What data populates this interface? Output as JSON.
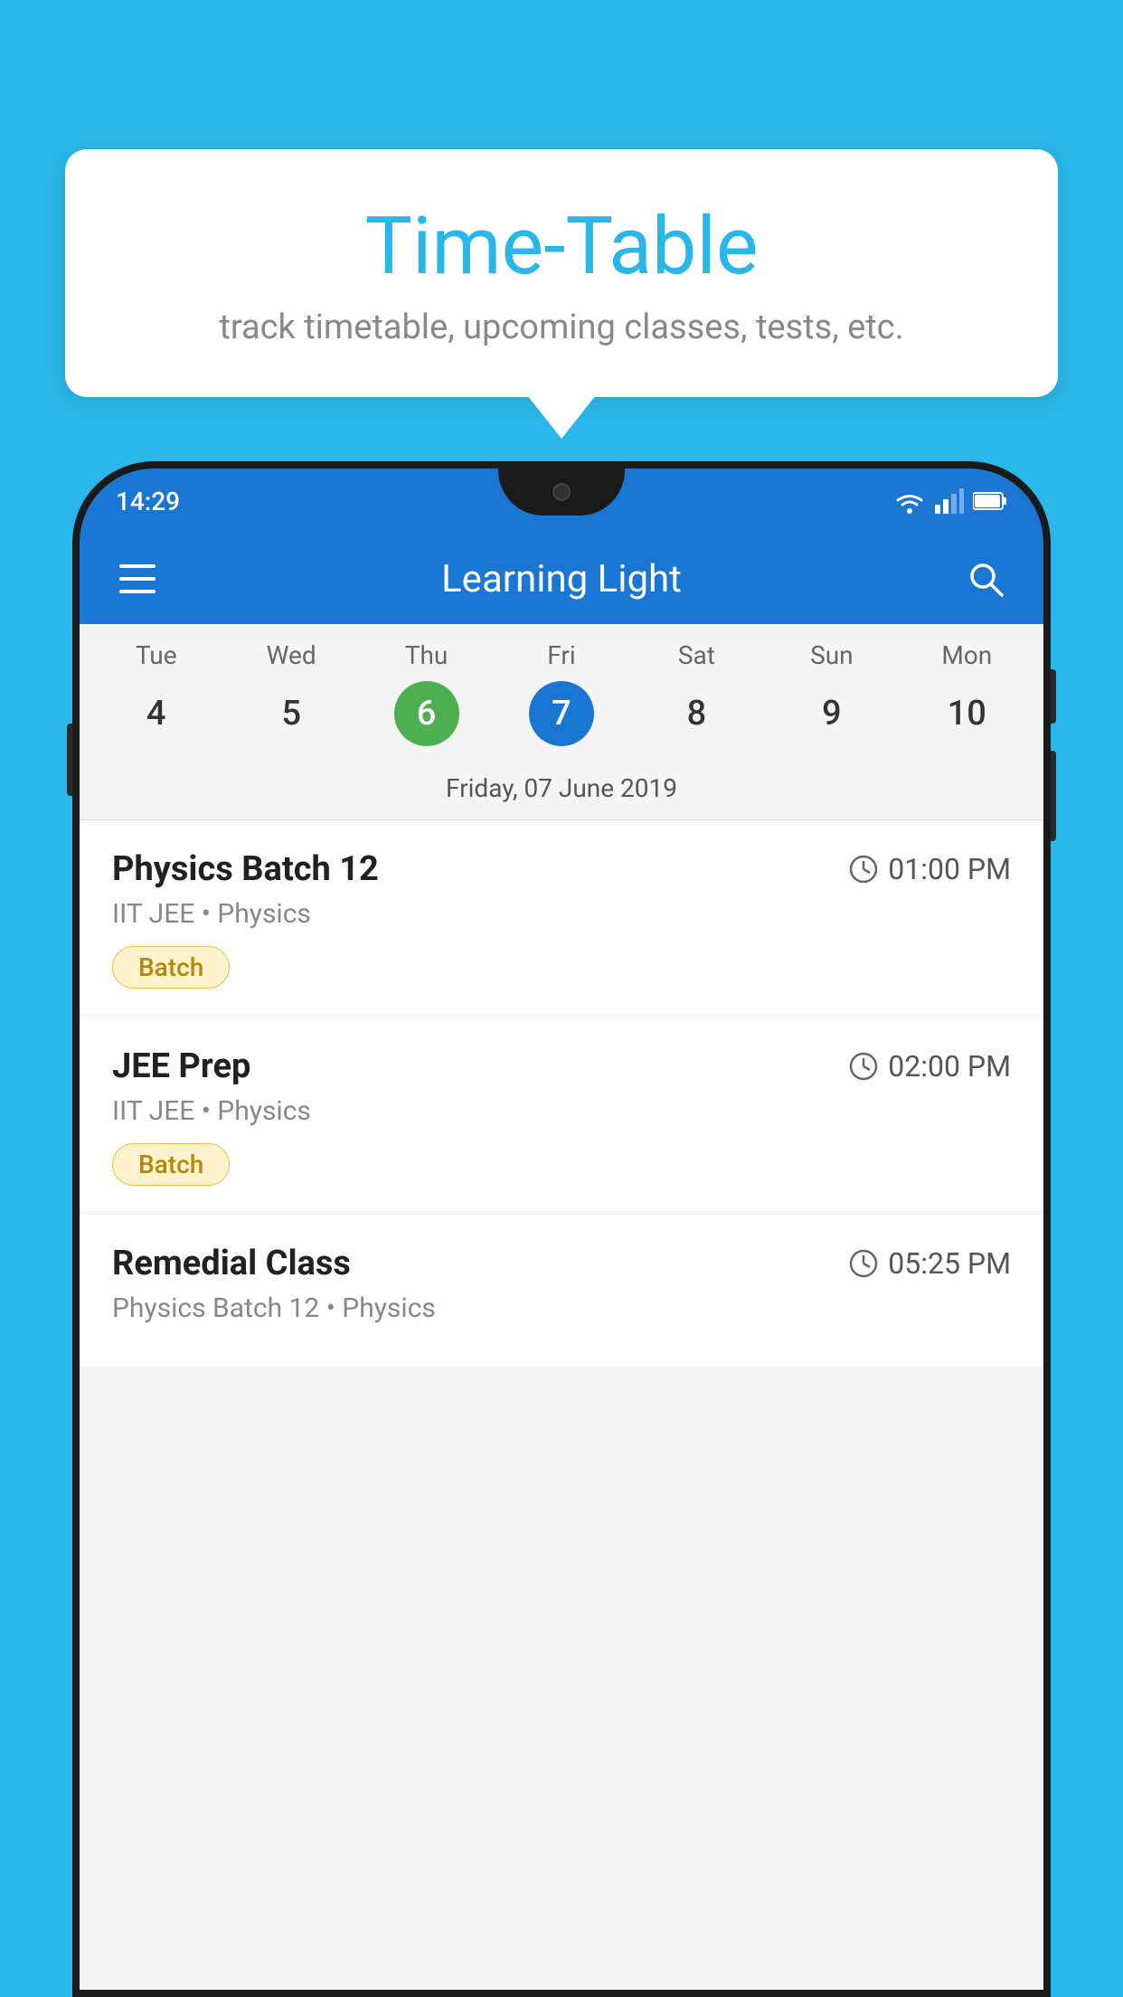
{
  "page": {
    "background_color": "#29b6e8"
  },
  "bubble": {
    "title": "Time-Table",
    "subtitle": "track timetable, upcoming classes, tests, etc."
  },
  "app_bar": {
    "title": "Learning Light",
    "menu_icon": "≡",
    "search_icon": "🔍"
  },
  "status_bar": {
    "time": "14:29"
  },
  "calendar": {
    "days_of_week": [
      "Tue",
      "Wed",
      "Thu",
      "Fri",
      "Sat",
      "Sun",
      "Mon"
    ],
    "dates": [
      "4",
      "5",
      "6",
      "7",
      "8",
      "9",
      "10"
    ],
    "today_index": 2,
    "selected_index": 3,
    "selected_label": "Friday, 07 June 2019"
  },
  "schedule": {
    "items": [
      {
        "title": "Physics Batch 12",
        "time": "01:00 PM",
        "subtitle": "IIT JEE • Physics",
        "badge": "Batch"
      },
      {
        "title": "JEE Prep",
        "time": "02:00 PM",
        "subtitle": "IIT JEE • Physics",
        "badge": "Batch"
      },
      {
        "title": "Remedial Class",
        "time": "05:25 PM",
        "subtitle": "Physics Batch 12 • Physics",
        "badge": null
      }
    ]
  }
}
